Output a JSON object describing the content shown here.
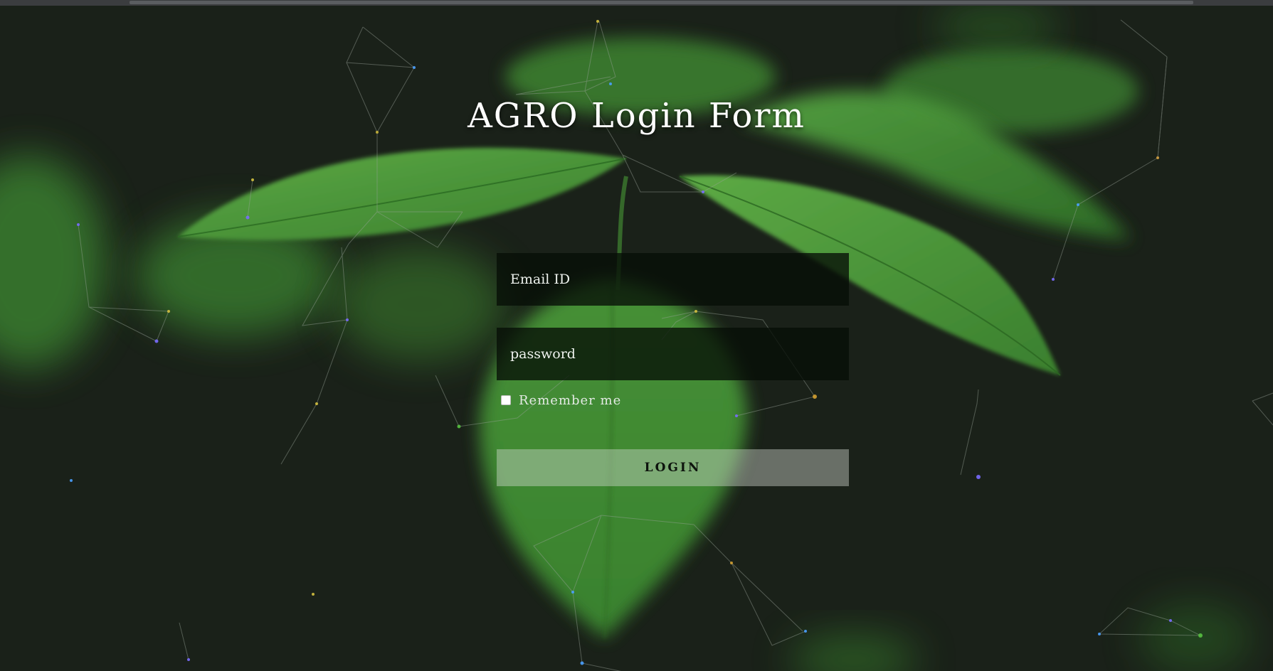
{
  "page": {
    "title": "AGRO Login Form"
  },
  "form": {
    "email_placeholder": "Email ID",
    "password_placeholder": "password",
    "remember_label": "Remember me",
    "login_label": "LOGIN"
  },
  "colors": {
    "background": "#1a2119",
    "leaf_green": "#4a9a3c",
    "field_background": "#0a120a",
    "button_background": "#b8beb4"
  }
}
